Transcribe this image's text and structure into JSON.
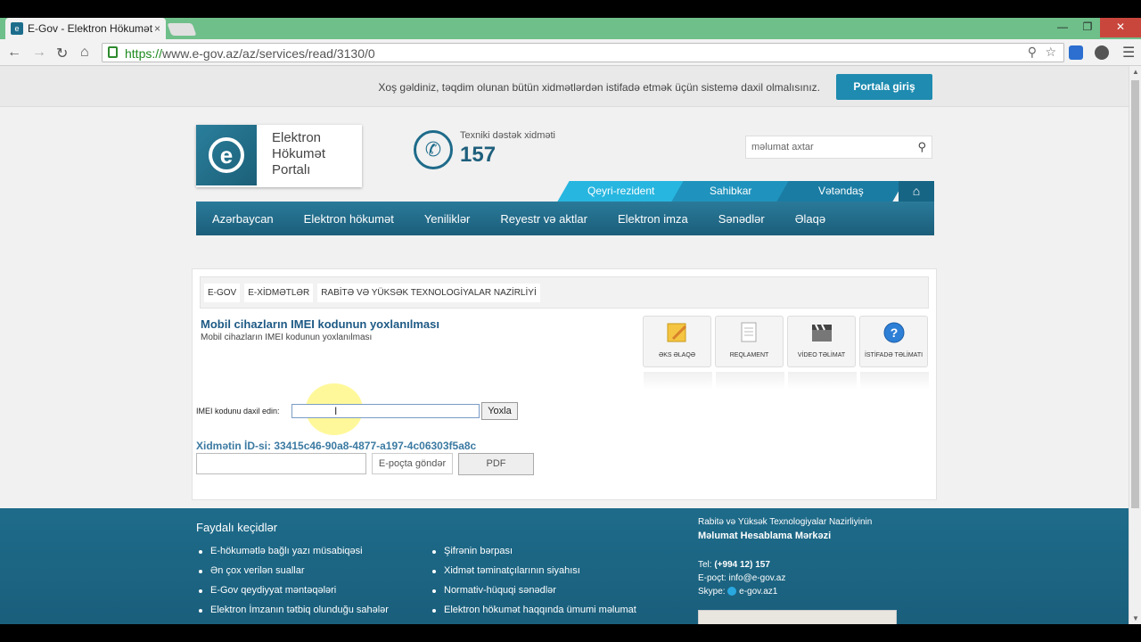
{
  "browser": {
    "tab_title": "E-Gov - Elektron Hökumət",
    "tab_close": "×",
    "url_scheme": "https://",
    "url_rest": "www.e-gov.az/az/services/read/3130/0"
  },
  "welcome": {
    "message": "Xoş gəldiniz, təqdim olunan bütün xidmətlərdən istifadə etmək üçün sistemə daxil olmalısınız.",
    "login_button": "Portala giriş"
  },
  "logo": {
    "line1": "Elektron",
    "line2": "Hökumət",
    "line3": "Portalı"
  },
  "support": {
    "label": "Texniki dəstək xidməti",
    "number": "157"
  },
  "search": {
    "placeholder": "məlumat axtar"
  },
  "audience": {
    "items": [
      "Qeyri-rezident",
      "Sahibkar",
      "Vətəndaş"
    ]
  },
  "nav": {
    "items": [
      "Azərbaycan",
      "Elektron hökumət",
      "Yeniliklər",
      "Reyestr və aktlar",
      "Elektron imza",
      "Sənədlər",
      "Əlaqə"
    ]
  },
  "breadcrumbs": [
    "E-GOV",
    "E-XİDMƏTLƏR",
    "RABİTƏ VƏ YÜKSƏK TEXNOLOGİYALAR NAZİRLİYİ"
  ],
  "service": {
    "title": "Mobil cihazların IMEI kodunun yoxlanılması",
    "subtitle": "Mobil cihazların IMEI kodunun yoxlanılması",
    "imei_label": "IMEI kodunu daxil edin:",
    "check_button": "Yoxla",
    "id_text": "Xidmətin İD-si: 33415c46-90a8-4877-a197-4c06303f5a8c",
    "email_button": "E-poçta göndər",
    "pdf_button": "PDF"
  },
  "tools": [
    {
      "label": "ƏKS ƏLAQƏ"
    },
    {
      "label": "REQLAMENT"
    },
    {
      "label": "VİDEO TƏLİMAT"
    },
    {
      "label": "İSTİFADƏ TƏLİMATI"
    }
  ],
  "footer": {
    "title": "Faydalı keçidlər",
    "col1": [
      "E-hökumətlə bağlı yazı müsabiqəsi",
      "Ən çox verilən suallar",
      "E-Gov qeydiyyat məntəqələri",
      "Elektron İmzanın tətbiq olunduğu sahələr"
    ],
    "col2": [
      "Şifrənin bərpası",
      "Xidmət təminatçılarının siyahısı",
      "Normativ-hüquqi sənədlər",
      "Elektron hökumət haqqında ümumi məlumat"
    ],
    "org_line1": "Rabitə və Yüksək Texnologiyalar Nazirliyinin",
    "org_line2": "Məlumat Hesablama Mərkəzi",
    "tel_label": "Tel:",
    "tel_value": "(+994 12) 157",
    "email_label": "E-poçt:",
    "email_value": "info@e-gov.az",
    "skype_label": "Skype:",
    "skype_value": "e-gov.az1"
  }
}
